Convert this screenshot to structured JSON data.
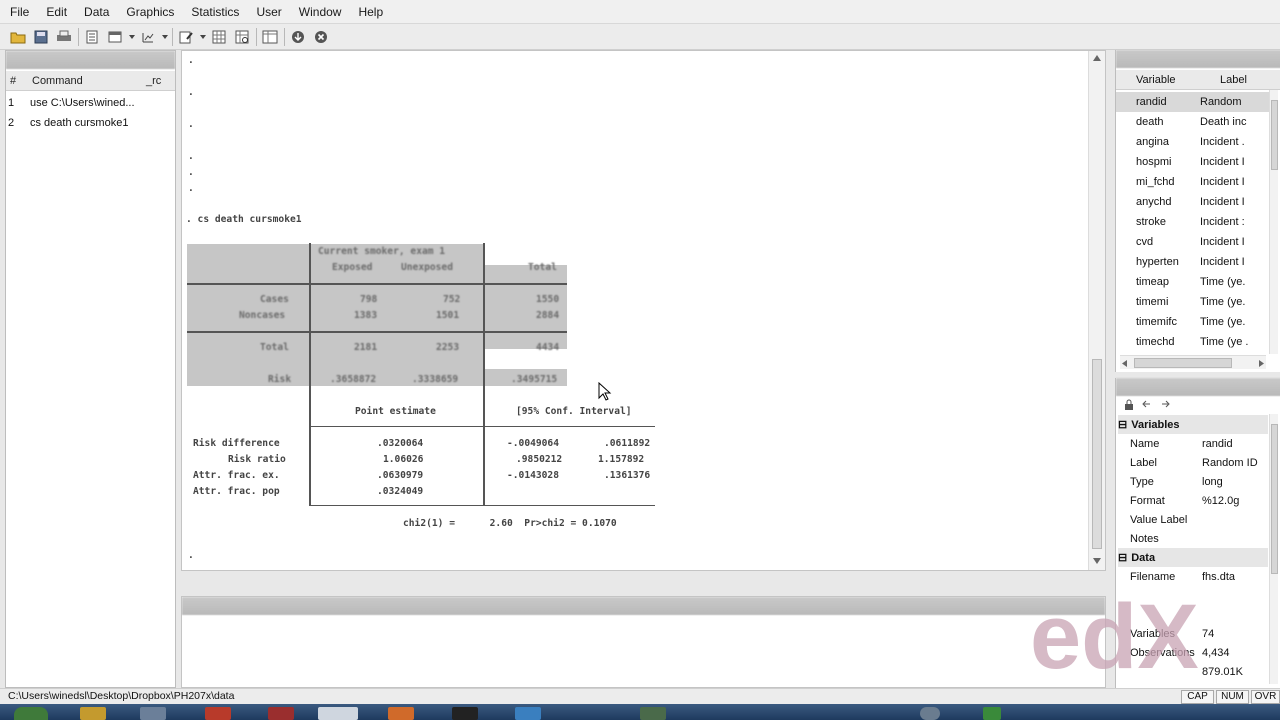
{
  "menu": [
    "File",
    "Edit",
    "Data",
    "Graphics",
    "Statistics",
    "User",
    "Window",
    "Help"
  ],
  "review": {
    "columns": [
      "#",
      "Command",
      "_rc"
    ],
    "rows": [
      {
        "num": "1",
        "command": "use C:\\Users\\wined..."
      },
      {
        "num": "2",
        "command": "cs death cursmoke1"
      }
    ]
  },
  "results": {
    "dots_top": [
      ".",
      ".",
      ".",
      ".",
      ".",
      "."
    ],
    "command_echo": ". cs death cursmoke1",
    "table": {
      "group_header": "Current smoker, exam 1",
      "col_exposed": "Exposed",
      "col_unexposed": "Unexposed",
      "col_total": "Total",
      "rows": [
        {
          "label": "Cases",
          "exposed": "798",
          "unexposed": "752",
          "total": "1550"
        },
        {
          "label": "Noncases",
          "exposed": "1383",
          "unexposed": "1501",
          "total": "2884"
        },
        {
          "label": "Total",
          "exposed": "2181",
          "unexposed": "2253",
          "total": "4434"
        },
        {
          "label": "Risk",
          "exposed": ".3658872",
          "unexposed": ".3338659",
          "total": ".3495715"
        }
      ]
    },
    "estimates": {
      "header_point": "Point estimate",
      "header_ci": "[95% Conf. Interval]",
      "rows": [
        {
          "label": "Risk difference",
          "point": ".0320064",
          "lo": "-.0049064",
          "hi": ".0611892"
        },
        {
          "label": "Risk ratio",
          "point": "1.06026",
          "lo": ".9850212",
          "hi": "1.157892"
        },
        {
          "label": "Attr. frac. ex.",
          "point": ".0630979",
          "lo": "-.0143028",
          "hi": ".1361376"
        },
        {
          "label": "Attr. frac. pop",
          "point": ".0324049",
          "lo": "",
          "hi": ""
        }
      ]
    },
    "chi2": "chi2(1) =      2.60  Pr>chi2 = 0.1070",
    "prompt_dot": "."
  },
  "variables": {
    "columns": [
      "Variable",
      "Label"
    ],
    "rows": [
      {
        "name": "randid",
        "label": "Random"
      },
      {
        "name": "death",
        "label": "Death inc"
      },
      {
        "name": "angina",
        "label": "Incident ."
      },
      {
        "name": "hospmi",
        "label": "Incident I"
      },
      {
        "name": "mi_fchd",
        "label": "Incident I"
      },
      {
        "name": "anychd",
        "label": "Incident I"
      },
      {
        "name": "stroke",
        "label": "Incident :"
      },
      {
        "name": "cvd",
        "label": "Incident I"
      },
      {
        "name": "hyperten",
        "label": "Incident I"
      },
      {
        "name": "timeap",
        "label": "Time (ye."
      },
      {
        "name": "timemi",
        "label": "Time (ye."
      },
      {
        "name": "timemifc",
        "label": "Time (ye."
      },
      {
        "name": "timechd",
        "label": "Time (ye ."
      }
    ]
  },
  "properties": {
    "variables_section": "Variables",
    "variables_rows": [
      {
        "key": "Name",
        "value": "randid"
      },
      {
        "key": "Label",
        "value": "Random ID"
      },
      {
        "key": "Type",
        "value": "long"
      },
      {
        "key": "Format",
        "value": "%12.0g"
      },
      {
        "key": "Value Label",
        "value": ""
      },
      {
        "key": "Notes",
        "value": ""
      }
    ],
    "data_section": "Data",
    "data_rows": [
      {
        "key": "Filename",
        "value": "fhs.dta"
      },
      {
        "key": "Variables",
        "value": "74"
      },
      {
        "key": "Observations",
        "value": "4,434"
      },
      {
        "key": "",
        "value": "879.01K"
      }
    ]
  },
  "status": {
    "path": "C:\\Users\\winedsl\\Desktop\\Dropbox\\PH207x\\data",
    "indicators": [
      "CAP",
      "NUM",
      "OVR"
    ]
  },
  "watermark": "edX",
  "colors": {
    "selection": "#c6c6c6",
    "taskbar": "#2a4a70"
  }
}
